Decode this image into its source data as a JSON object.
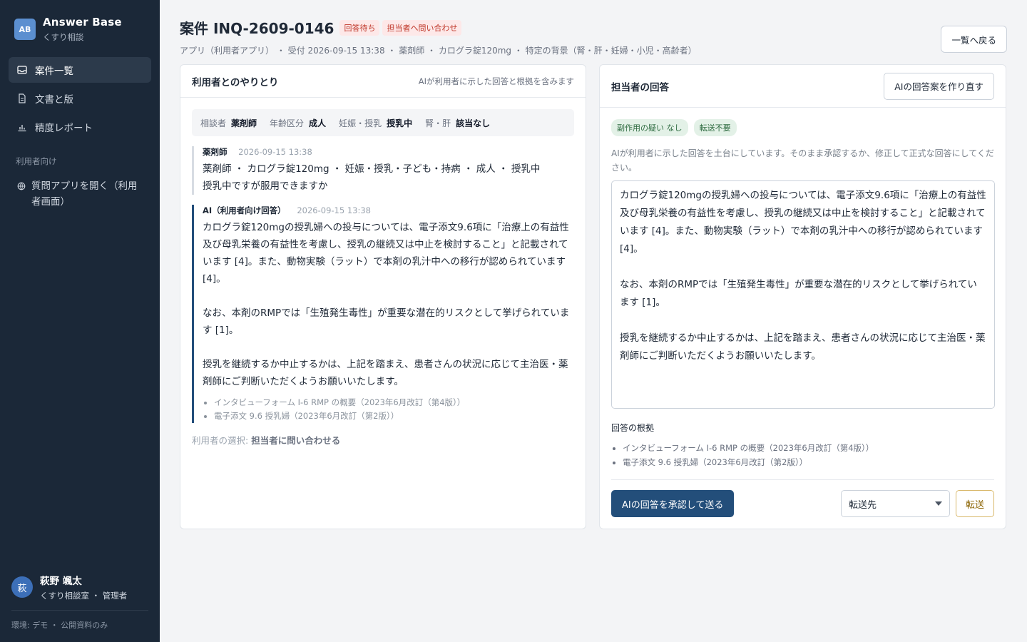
{
  "sidebar": {
    "logo": "AB",
    "brand_title": "Answer Base",
    "brand_sub": "くすり相談",
    "items": [
      {
        "label": "案件一覧",
        "icon": "inbox-icon"
      },
      {
        "label": "文書と版",
        "icon": "document-icon"
      },
      {
        "label": "精度レポート",
        "icon": "bar-chart-icon"
      }
    ],
    "section_label": "利用者向け",
    "open_app": "質問アプリを開く（利用者画面）",
    "user": {
      "initial": "萩",
      "name": "萩野 颯太",
      "role": "くすり相談室 ・ 管理者"
    },
    "env": "環境: デモ ・ 公開資料のみ"
  },
  "header": {
    "title": "案件 INQ-2609-0146",
    "badge_status": "回答待ち",
    "badge_contact": "担当者へ問い合わせ",
    "meta": "アプリ（利用者アプリ） ・ 受付 2026-09-15 13:38 ・ 薬剤師 ・ カログラ錠120mg ・ 特定の背景（腎・肝・妊婦・小児・高齢者）",
    "back_label": "一覧へ戻る"
  },
  "conversation": {
    "title": "利用者とのやりとり",
    "hint": "AIが利用者に示した回答と根拠を含みます",
    "profile": {
      "k1": "相談者",
      "v1": "薬剤師",
      "k2": "年齢区分",
      "v2": "成人",
      "k3": "妊娠・授乳",
      "v3": "授乳中",
      "k4": "腎・肝",
      "v4": "該当なし"
    },
    "user_msg": {
      "author": "薬剤師",
      "time": "2026-09-15 13:38",
      "text": "薬剤師 ・ カログラ錠120mg ・ 妊娠・授乳・子ども・持病 ・ 成人 ・ 授乳中\n授乳中ですが服用できますか"
    },
    "ai_msg": {
      "author": "AI（利用者向け回答）",
      "time": "2026-09-15 13:38",
      "text": "カログラ錠120mgの授乳婦への投与については、電子添文9.6項に「治療上の有益性及び母乳栄養の有益性を考慮し、授乳の継続又は中止を検討すること」と記載されています [4]。また、動物実験（ラット）で本剤の乳汁中への移行が認められています [4]。\n\nなお、本剤のRMPでは「生殖発生毒性」が重要な潜在的リスクとして挙げられています [1]。\n\n授乳を継続するか中止するかは、上記を踏まえ、患者さんの状況に応じて主治医・薬剤師にご判断いただくようお願いいたします。",
      "sources": [
        "インタビューフォーム Ⅰ-6 RMP の概要（2023年6月改訂（第4版））",
        "電子添文 9.6 授乳婦（2023年6月改訂（第2版））"
      ]
    },
    "choice_label": "利用者の選択:",
    "choice_value": "担当者に問い合わせる"
  },
  "reply": {
    "title": "担当者の回答",
    "regen_label": "AIの回答案を作り直す",
    "tag1": "副作用の疑い なし",
    "tag2": "転送不要",
    "note": "AIが利用者に示した回答を土台にしています。そのまま承認するか、修正して正式な回答にしてください。",
    "draft": "カログラ錠120mgの授乳婦への投与については、電子添文9.6項に「治療上の有益性及び母乳栄養の有益性を考慮し、授乳の継続又は中止を検討すること」と記載されています [4]。また、動物実験（ラット）で本剤の乳汁中への移行が認められています [4]。\n\nなお、本剤のRMPでは「生殖発生毒性」が重要な潜在的リスクとして挙げられています [1]。\n\n授乳を継続するか中止するかは、上記を踏まえ、患者さんの状況に応じて主治医・薬剤師にご判断いただくようお願いいたします。",
    "basis_title": "回答の根拠",
    "basis": [
      "インタビューフォーム Ⅰ-6 RMP の概要（2023年6月改訂（第4版））",
      "電子添文 9.6 授乳婦（2023年6月改訂（第2版））"
    ],
    "approve_label": "AIの回答を承認して送る",
    "forward_select": "転送先",
    "forward_label": "転送"
  }
}
